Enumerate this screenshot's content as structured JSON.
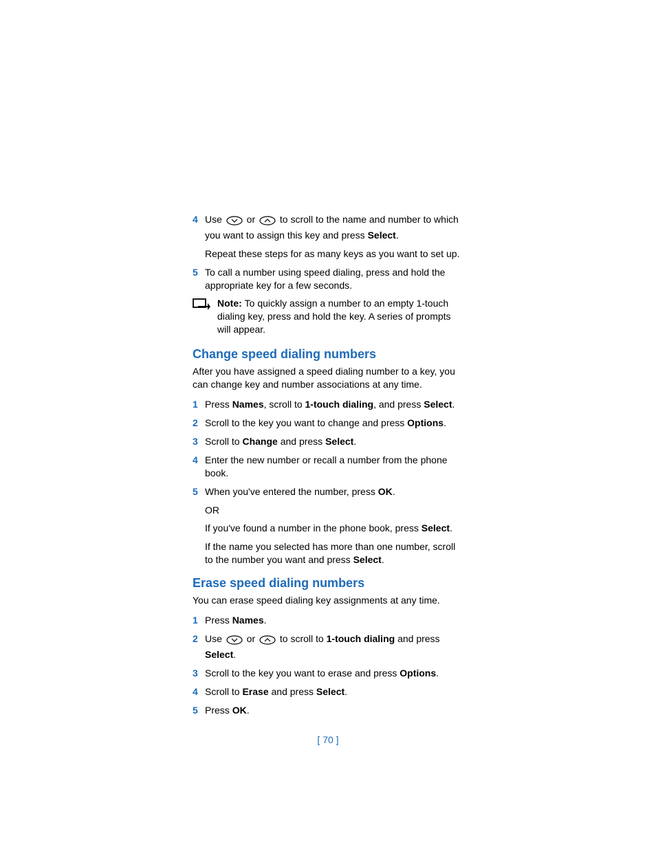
{
  "sectionA": {
    "step4_pre": "Use ",
    "step4_mid": " or ",
    "step4_post": " to scroll to the name and number to which you want to assign this key and press ",
    "step4_bold": "Select",
    "step4_end": ".",
    "step4_sub": "Repeat these steps for as many keys as you want to set up.",
    "step5": "To call a number using speed dialing, press and hold the appropriate key for a few seconds.",
    "note_label": "Note: ",
    "note_body": " To quickly assign a number to an empty 1-touch dialing key, press and hold the key. A series of prompts will appear."
  },
  "sectionB": {
    "heading": "Change speed dialing numbers",
    "intro": "After you have assigned a speed dialing number to a key, you can change key and number associations at any time.",
    "s1_a": "Press ",
    "s1_b": "Names",
    "s1_c": ", scroll to ",
    "s1_d": "1-touch dialing",
    "s1_e": ", and press ",
    "s1_f": "Select",
    "s1_g": ".",
    "s2_a": "Scroll to the key you want to change and press ",
    "s2_b": "Options",
    "s2_c": ".",
    "s3_a": "Scroll to ",
    "s3_b": "Change",
    "s3_c": " and press ",
    "s3_d": "Select",
    "s3_e": ".",
    "s4": "Enter the new number or recall a number from the phone book.",
    "s5_a": "When you've entered the number, press ",
    "s5_b": "OK",
    "s5_c": ".",
    "s5_or": "OR",
    "s5_sub1_a": "If you've found a number in the phone book, press ",
    "s5_sub1_b": "Select",
    "s5_sub1_c": ".",
    "s5_sub2_a": "If the name you selected has more than one number, scroll to the number you want and press ",
    "s5_sub2_b": "Select",
    "s5_sub2_c": "."
  },
  "sectionC": {
    "heading": "Erase speed dialing numbers",
    "intro": "You can erase speed dialing key assignments at any time.",
    "s1_a": "Press ",
    "s1_b": "Names",
    "s1_c": ".",
    "s2_a": "Use ",
    "s2_b": " or ",
    "s2_c": " to scroll to ",
    "s2_d": "1-touch dialing",
    "s2_e": " and press ",
    "s2_f": "Select",
    "s2_g": ".",
    "s3_a": "Scroll to the key you want to erase and press ",
    "s3_b": "Options",
    "s3_c": ".",
    "s4_a": "Scroll to ",
    "s4_b": "Erase",
    "s4_c": " and press ",
    "s4_d": "Select",
    "s4_e": ".",
    "s5_a": "Press ",
    "s5_b": "OK",
    "s5_c": "."
  },
  "nums": {
    "n1": "1",
    "n2": "2",
    "n3": "3",
    "n4": "4",
    "n5": "5"
  },
  "pagenum": "[ 70 ]"
}
